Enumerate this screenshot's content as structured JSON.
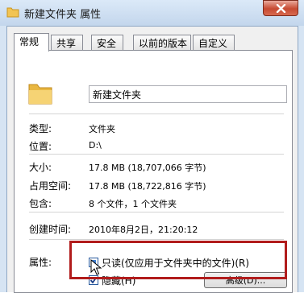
{
  "window": {
    "title": "新建文件夹 属性",
    "close_glyph": "✕"
  },
  "tabs": [
    {
      "label": "常规"
    },
    {
      "label": "共享"
    },
    {
      "label": "安全"
    },
    {
      "label": "以前的版本"
    },
    {
      "label": "自定义"
    }
  ],
  "general": {
    "folder_name": "新建文件夹",
    "type_label": "类型:",
    "type_value": "文件夹",
    "location_label": "位置:",
    "location_value": "D:\\",
    "size_label": "大小:",
    "size_value": "17.8 MB (18,707,066 字节)",
    "size_on_disk_label": "占用空间:",
    "size_on_disk_value": "17.8 MB (18,722,816 字节)",
    "contains_label": "包含:",
    "contains_value": "8 个文件，1 个文件夹",
    "created_label": "创建时间:",
    "created_value": "2010年8月2日，21:20:12",
    "attributes_label": "属性:",
    "readonly_label": "只读(仅应用于文件夹中的文件)(R)",
    "hidden_label": "隐藏(H)",
    "advanced_button": "高级(D)..."
  },
  "colors": {
    "highlight": "#b11c1c",
    "folder": "#f2c453"
  }
}
